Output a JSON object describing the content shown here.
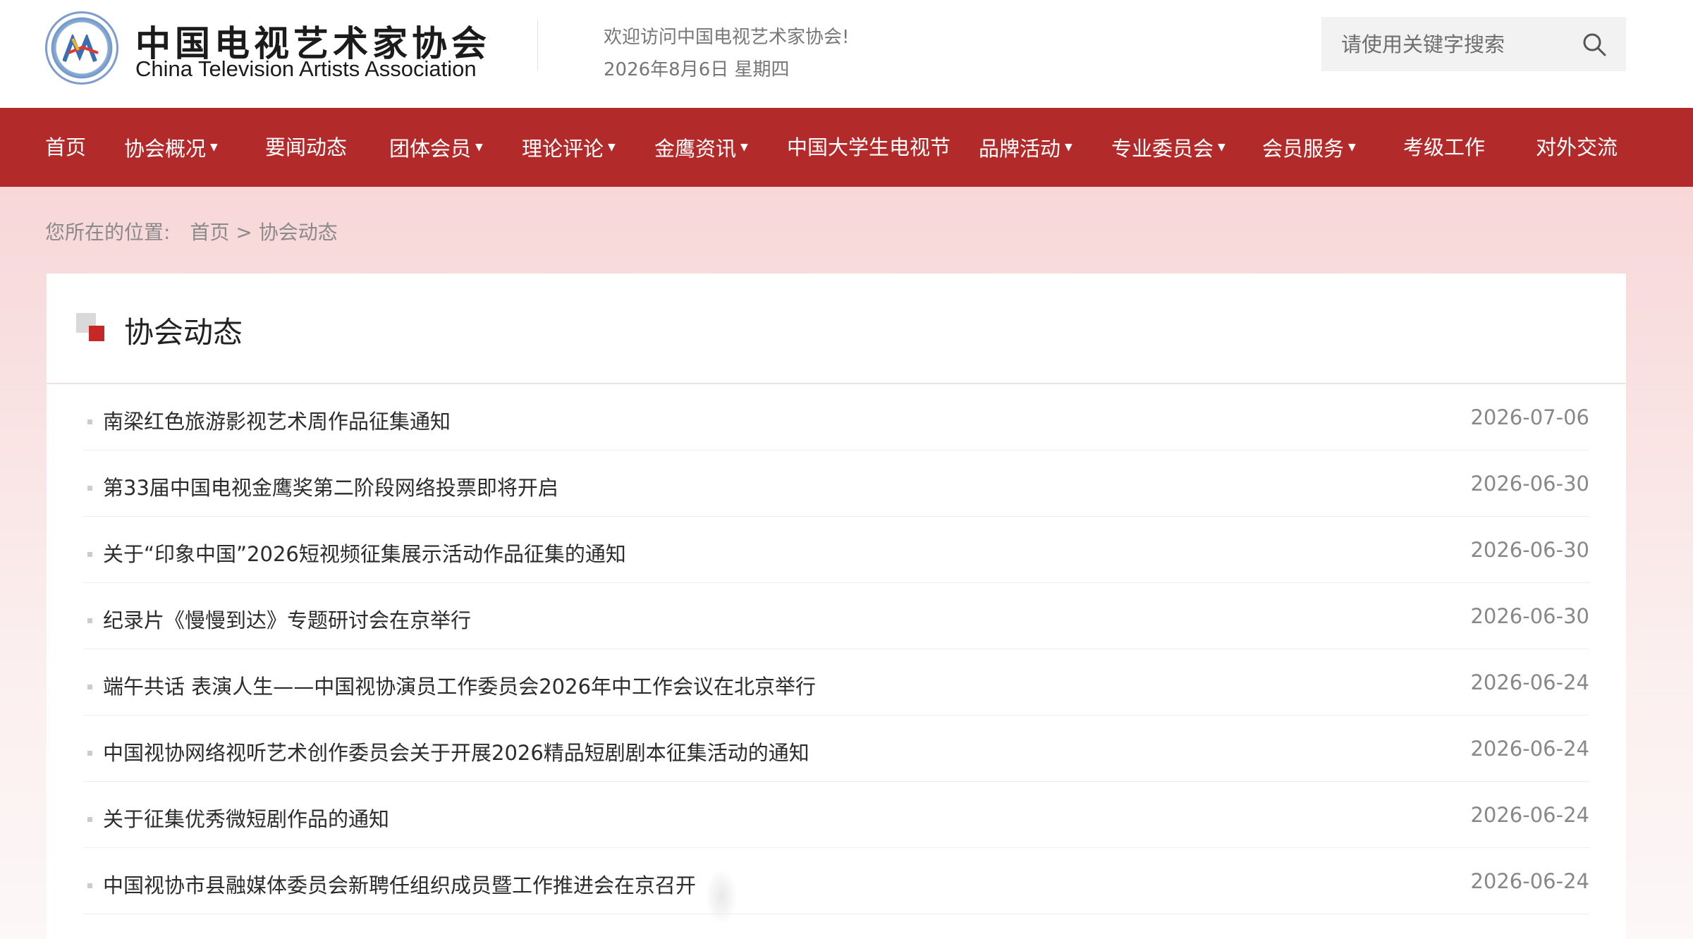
{
  "header": {
    "brand_cn": "中国电视艺术家协会",
    "brand_en": "China Television Artists Association",
    "welcome": "欢迎访问中国电视艺术家协会!",
    "date": "2026年8月6日 星期四",
    "search_placeholder": "请使用关键字搜索"
  },
  "nav": {
    "items": [
      {
        "label": "首页",
        "dropdown": false
      },
      {
        "label": "协会概况",
        "dropdown": true
      },
      {
        "label": "要闻动态",
        "dropdown": false
      },
      {
        "label": "团体会员",
        "dropdown": true
      },
      {
        "label": "理论评论",
        "dropdown": true
      },
      {
        "label": "金鹰资讯",
        "dropdown": true
      },
      {
        "label": "中国大学生电视节",
        "dropdown": false
      },
      {
        "label": "品牌活动",
        "dropdown": true
      },
      {
        "label": "专业委员会",
        "dropdown": true
      },
      {
        "label": "会员服务",
        "dropdown": true
      },
      {
        "label": "考级工作",
        "dropdown": false
      },
      {
        "label": "对外交流",
        "dropdown": false
      }
    ],
    "caret": "▼"
  },
  "breadcrumb": {
    "prefix": "您所在的位置:",
    "home": "首页",
    "separator": " > ",
    "current": "协会动态"
  },
  "section": {
    "title": "协会动态"
  },
  "news": [
    {
      "title": "南梁红色旅游影视艺术周作品征集通知",
      "date": "2026-07-06"
    },
    {
      "title": "第33届中国电视金鹰奖第二阶段网络投票即将开启",
      "date": "2026-06-30"
    },
    {
      "title": "关于“印象中国”2026短视频征集展示活动作品征集的通知",
      "date": "2026-06-30"
    },
    {
      "title": "纪录片《慢慢到达》专题研讨会在京举行",
      "date": "2026-06-30"
    },
    {
      "title": "端午共话 表演人生——中国视协演员工作委员会2026年中工作会议在北京举行",
      "date": "2026-06-24"
    },
    {
      "title": "中国视协网络视听艺术创作委员会关于开展2026精品短剧剧本征集活动的通知",
      "date": "2026-06-24"
    },
    {
      "title": "关于征集优秀微短剧作品的通知",
      "date": "2026-06-24"
    },
    {
      "title": "中国视协市县融媒体委员会新聘任组织成员暨工作推进会在京召开",
      "date": "2026-06-24"
    }
  ],
  "colors": {
    "nav_bg": "#b22a2a",
    "accent_red": "#c62828",
    "content_bg": "#f8d7d8"
  },
  "icons": {
    "search": "search-icon",
    "logo": "cctaa-logo-icon",
    "title": "section-title-icon"
  }
}
